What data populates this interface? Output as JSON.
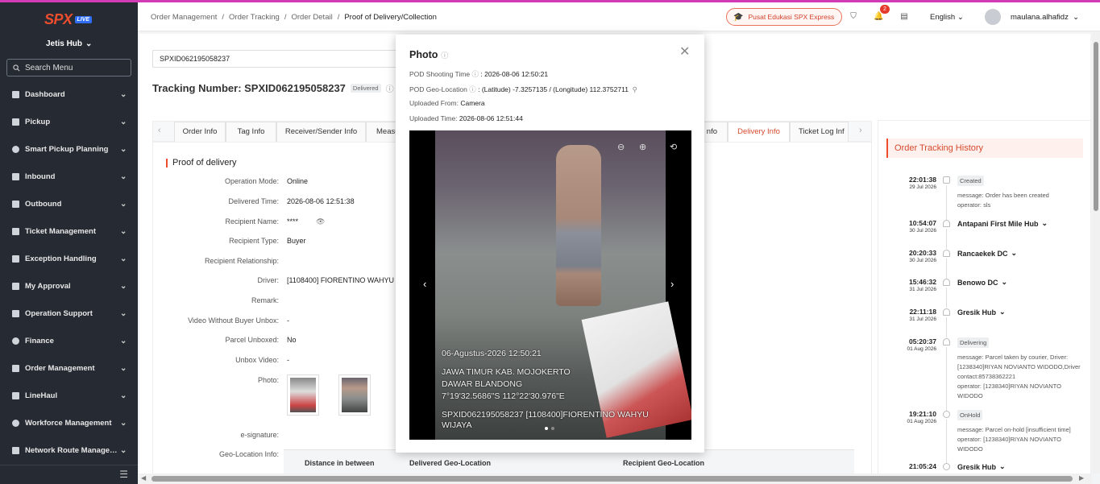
{
  "sidebar": {
    "logo_text": "SPX",
    "logo_badge": "LIVE",
    "hub": "Jetis Hub",
    "search_placeholder": "Search Menu",
    "items": [
      {
        "label": "Dashboard"
      },
      {
        "label": "Pickup"
      },
      {
        "label": "Smart Pickup Planning"
      },
      {
        "label": "Inbound"
      },
      {
        "label": "Outbound"
      },
      {
        "label": "Ticket Management"
      },
      {
        "label": "Exception Handling"
      },
      {
        "label": "My Approval"
      },
      {
        "label": "Operation Support"
      },
      {
        "label": "Finance"
      },
      {
        "label": "Order Management"
      },
      {
        "label": "LineHaul"
      },
      {
        "label": "Workforce Management"
      },
      {
        "label": "Network Route Managem..."
      }
    ]
  },
  "header": {
    "breadcrumbs": [
      "Order Management",
      "Order Tracking",
      "Order Detail",
      "Proof of Delivery/Collection"
    ],
    "edu_button": "Pusat Edukasi SPX Express",
    "notification_count": "2",
    "language": "English",
    "username": "maulana.alhafidz"
  },
  "main": {
    "tracking_input": "SPXID062195058237",
    "tracking_number_label": "Tracking Number: SPXID062195058237",
    "tracking_status": "Delivered",
    "tabs": [
      {
        "label": "Order Info"
      },
      {
        "label": "Tag Info"
      },
      {
        "label": "Receiver/Sender Info"
      },
      {
        "label": "Measu"
      },
      {
        "label": "nfo"
      },
      {
        "label": "Delivery Info"
      },
      {
        "label": "Ticket Log Inf"
      }
    ],
    "section_title": "Proof of delivery",
    "fields": [
      {
        "key": "Operation Mode:",
        "value": "Online"
      },
      {
        "key": "Delivered Time:",
        "value": "2026-08-06 12:51:38"
      },
      {
        "key": "Recipient Name:",
        "value": "****"
      },
      {
        "key": "Recipient Type:",
        "value": "Buyer"
      },
      {
        "key": "Recipient Relationship:",
        "value": ""
      },
      {
        "key": "Driver:",
        "value": "[1108400] FIORENTINO WAHYU W"
      },
      {
        "key": "Remark:",
        "value": ""
      },
      {
        "key": "Video Without Buyer Unbox:",
        "value": "-"
      },
      {
        "key": "Parcel Unboxed:",
        "value": "No"
      },
      {
        "key": "Unbox Video:",
        "value": "-"
      },
      {
        "key": "Photo:",
        "value": ""
      },
      {
        "key": "e-signature:",
        "value": ""
      },
      {
        "key": "Geo-Location Info:",
        "value": ""
      }
    ],
    "geo_table_headers": [
      "Distance in between",
      "Delivered Geo-Location",
      "Recipient Geo-Location"
    ]
  },
  "tracking_history": {
    "title": "Order Tracking History",
    "events": [
      {
        "time": "22:01:38",
        "date": "29 Jul 2026",
        "status": "Created",
        "message": "message: Order has been created",
        "operator": "operator: sls"
      },
      {
        "time": "10:54:07",
        "date": "30 Jul 2026",
        "hub": "Antapani First Mile Hub"
      },
      {
        "time": "20:20:33",
        "date": "30 Jul 2026",
        "hub": "Rancaekek DC"
      },
      {
        "time": "15:46:32",
        "date": "31 Jul 2026",
        "hub": "Benowo DC"
      },
      {
        "time": "22:11:18",
        "date": "31 Jul 2026",
        "hub": "Gresik Hub"
      },
      {
        "time": "05:20:37",
        "date": "01 Aug 2026",
        "status": "Delivering",
        "message": "message: Parcel taken by courier, Driver: [1238340]RIYAN NOVIANTO WIDODO,Driver contact:85738362221",
        "operator": "operator: [1238340]RIYAN NOVIANTO WIDODO"
      },
      {
        "time": "19:21:10",
        "date": "01 Aug 2026",
        "status": "OnHold",
        "message": "message: Parcel on-hold [insufficient time]",
        "operator": "operator: [1238340]RIYAN NOVIANTO WIDODO"
      },
      {
        "time": "21:05:24",
        "date": "",
        "hub": "Gresik Hub"
      }
    ]
  },
  "modal": {
    "title": "Photo",
    "shooting_time_label": "POD Shooting Time",
    "shooting_time": ": 2026-08-06 12:50:21",
    "geo_label": "POD Geo-Location",
    "geo_value": ": (Latitude) -7.3257135 / (Longitude) 112.3752711",
    "uploaded_from_label": "Uploaded From:",
    "uploaded_from": "Camera",
    "uploaded_time_label": "Uploaded Time:",
    "uploaded_time": "2026-08-06 12:51:44",
    "photo_overlay": {
      "line1": "06-Agustus-2026 12:50:21",
      "line2": "JAWA TIMUR KAB. MOJOKERTO",
      "line3": "DAWAR BLANDONG",
      "line4": "7°19'32.5686\"S 112°22'30.976\"E",
      "line5": "SPXID062195058237    [1108400]FIORENTINO WAHYU",
      "line6": "WIJAYA"
    }
  }
}
